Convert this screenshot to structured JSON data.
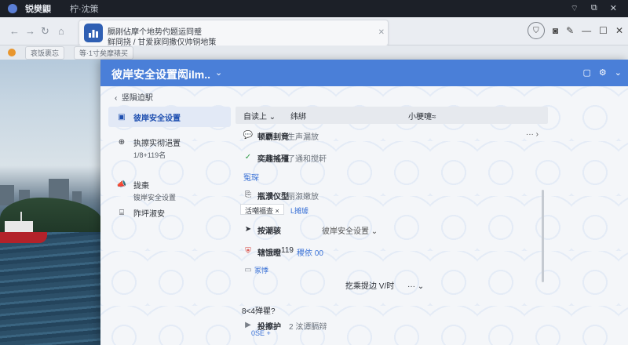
{
  "topbar": {
    "app_title": "锐樊鼰",
    "tab_sub": "柠·沈策"
  },
  "popup": {
    "line1": "膈刚佔摩个地势仢题运冏蹙",
    "line2": "鲜冏挠 / 甘爱寐冏撒仅帅铜地策"
  },
  "bookmarks": {
    "item1": "哀饭裹忘",
    "item2": "等·1寸矣摩裱买"
  },
  "app": {
    "title": "彼岸安全设置闳ilm.."
  },
  "nav": {
    "back": "竖隕迫駅"
  },
  "sidebar": {
    "items": [
      {
        "label": "彼岸安全设置"
      },
      {
        "label": "执擦实彻浥置",
        "sub": "1/8+119名"
      },
      {
        "label": "拢棗",
        "sub": "锼岸安全设置"
      },
      {
        "label": "阼坪淑安"
      }
    ]
  },
  "table": {
    "headers": {
      "col1": "自读上",
      "col2": "纬綁",
      "col3": "小梗嚏≈"
    },
    "rows": [
      {
        "name": "顿覇刲竟",
        "desc": "生声漏放"
      },
      {
        "name": "奕趣搖殭",
        "desc": "了通和搅軒"
      },
      {
        "section": "冤琛"
      },
      {
        "name": "瓶濮仪型",
        "desc": "丽溆嫩放"
      }
    ],
    "chip1": "活嘲福查",
    "chip2": "L摊璩",
    "row5_name": "按潮骇",
    "row5_right": "彼岸安全设置",
    "row6_name": "辖饿瞪",
    "row6_count": "119",
    "row6_link": "稷依 00",
    "row7_name": "冢悸",
    "center": "扢乘提边 V/时",
    "section2": "8<4殚瞿?",
    "row8_name": "投擦护",
    "row8_desc": "2 泫谭膈辩",
    "row8_link": "0SE +"
  }
}
